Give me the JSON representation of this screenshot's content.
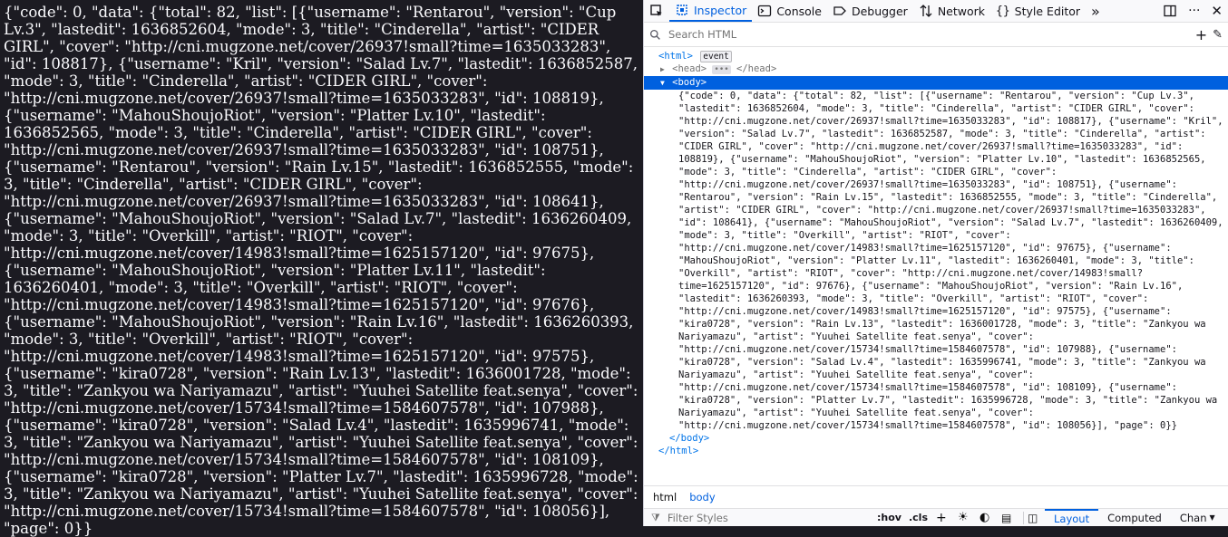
{
  "page": {
    "json_text": "{\"code\": 0, \"data\": {\"total\": 82, \"list\": [{\"username\": \"Rentarou\", \"version\": \"Cup Lv.3\", \"lastedit\": 1636852604, \"mode\": 3, \"title\": \"Cinderella\", \"artist\": \"CIDER GIRL\", \"cover\": \"http://cni.mugzone.net/cover/26937!small?time=1635033283\", \"id\": 108817}, {\"username\": \"Kril\", \"version\": \"Salad Lv.7\", \"lastedit\": 1636852587, \"mode\": 3, \"title\": \"Cinderella\", \"artist\": \"CIDER GIRL\", \"cover\": \"http://cni.mugzone.net/cover/26937!small?time=1635033283\", \"id\": 108819}, {\"username\": \"MahouShoujoRiot\", \"version\": \"Platter Lv.10\", \"lastedit\": 1636852565, \"mode\": 3, \"title\": \"Cinderella\", \"artist\": \"CIDER GIRL\", \"cover\": \"http://cni.mugzone.net/cover/26937!small?time=1635033283\", \"id\": 108751}, {\"username\": \"Rentarou\", \"version\": \"Rain Lv.15\", \"lastedit\": 1636852555, \"mode\": 3, \"title\": \"Cinderella\", \"artist\": \"CIDER GIRL\", \"cover\": \"http://cni.mugzone.net/cover/26937!small?time=1635033283\", \"id\": 108641}, {\"username\": \"MahouShoujoRiot\", \"version\": \"Salad Lv.7\", \"lastedit\": 1636260409, \"mode\": 3, \"title\": \"Overkill\", \"artist\": \"RIOT\", \"cover\": \"http://cni.mugzone.net/cover/14983!small?time=1625157120\", \"id\": 97675}, {\"username\": \"MahouShoujoRiot\", \"version\": \"Platter Lv.11\", \"lastedit\": 1636260401, \"mode\": 3, \"title\": \"Overkill\", \"artist\": \"RIOT\", \"cover\": \"http://cni.mugzone.net/cover/14983!small?time=1625157120\", \"id\": 97676}, {\"username\": \"MahouShoujoRiot\", \"version\": \"Rain Lv.16\", \"lastedit\": 1636260393, \"mode\": 3, \"title\": \"Overkill\", \"artist\": \"RIOT\", \"cover\": \"http://cni.mugzone.net/cover/14983!small?time=1625157120\", \"id\": 97575}, {\"username\": \"kira0728\", \"version\": \"Rain Lv.13\", \"lastedit\": 1636001728, \"mode\": 3, \"title\": \"Zankyou wa Nariyamazu\", \"artist\": \"Yuuhei Satellite feat.senya\", \"cover\": \"http://cni.mugzone.net/cover/15734!small?time=1584607578\", \"id\": 107988}, {\"username\": \"kira0728\", \"version\": \"Salad Lv.4\", \"lastedit\": 1635996741, \"mode\": 3, \"title\": \"Zankyou wa Nariyamazu\", \"artist\": \"Yuuhei Satellite feat.senya\", \"cover\": \"http://cni.mugzone.net/cover/15734!small?time=1584607578\", \"id\": 108109}, {\"username\": \"kira0728\", \"version\": \"Platter Lv.7\", \"lastedit\": 1635996728, \"mode\": 3, \"title\": \"Zankyou wa Nariyamazu\", \"artist\": \"Yuuhei Satellite feat.senya\", \"cover\": \"http://cni.mugzone.net/cover/15734!small?time=1584607578\", \"id\": 108056}], \"page\": 0}}"
  },
  "devtools": {
    "tabs": {
      "inspector": "Inspector",
      "console": "Console",
      "debugger": "Debugger",
      "network": "Network",
      "style_editor": "Style Editor"
    },
    "search_placeholder": "Search HTML",
    "tree": {
      "html_open": "<html>",
      "event_badge": "event",
      "head_open": "<head>",
      "head_ellipsis": "•••",
      "head_close": "</head>",
      "body_open": "<body>",
      "body_close": "</body>",
      "html_close": "</html>"
    },
    "breadcrumbs": [
      "html",
      "body"
    ],
    "filter_placeholder": "Filter Styles",
    "hov": ":hov",
    "cls": ".cls",
    "right_tabs": [
      "Layout",
      "Computed",
      "Chan"
    ]
  },
  "colors": {
    "accent": "#0060df",
    "page_bg": "#1c1b22"
  }
}
